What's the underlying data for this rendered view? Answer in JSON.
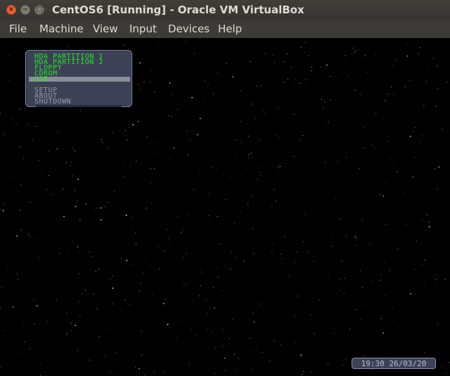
{
  "window": {
    "title": "CentOS6 [Running] - Oracle VM VirtualBox",
    "controls": {
      "close_icon": "close-icon",
      "minimize_icon": "minimize-icon",
      "maximize_icon": "maximize-icon"
    }
  },
  "menubar": {
    "items": [
      "File",
      "Machine",
      "View",
      "Input",
      "Devices",
      "Help"
    ]
  },
  "vm_screen": {
    "boot_menu": {
      "boot_items": [
        "HDA PARTITION 1",
        "HDA PARTITION 2",
        "FLOPPY",
        "CDROM",
        "USB"
      ],
      "selected_item": "USB",
      "system_items": [
        "SETUP",
        "ABOUT",
        "SHUTDOWN"
      ],
      "colors": {
        "boot_text": "#29e329",
        "system_text": "#9a9ba6",
        "panel_bg": "#3d4156",
        "highlight": "#8a8c99"
      }
    },
    "clock": "19:30 26/03/20",
    "background": "starfield"
  }
}
